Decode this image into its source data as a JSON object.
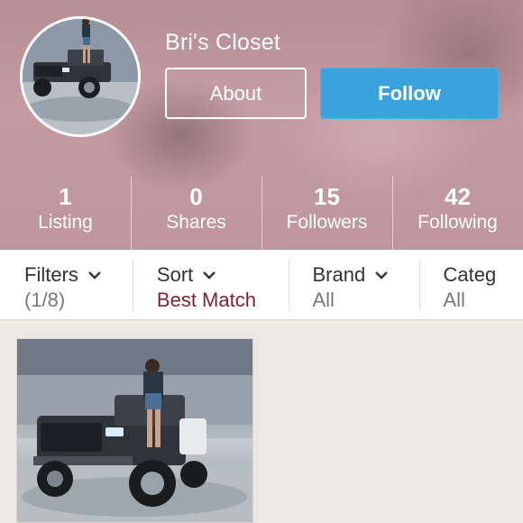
{
  "profile": {
    "shop_name": "Bri's Closet",
    "avatar_icon": "profile-photo-truck",
    "about_label": "About",
    "follow_label": "Follow"
  },
  "stats": [
    {
      "count": "1",
      "label": "Listing"
    },
    {
      "count": "0",
      "label": "Shares"
    },
    {
      "count": "15",
      "label": "Followers"
    },
    {
      "count": "42",
      "label": "Following"
    }
  ],
  "filters": [
    {
      "label": "Filters",
      "value": "(1/8)"
    },
    {
      "label": "Sort",
      "value": "Best Match"
    },
    {
      "label": "Brand",
      "value": "All"
    },
    {
      "label": "Categ",
      "value": "All"
    }
  ],
  "colors": {
    "follow_button": "#3aa3df",
    "sort_value": "#7b2432",
    "header_tint": "#bf969c"
  },
  "listings": [
    {
      "image_icon": "listing-photo-truck"
    }
  ]
}
